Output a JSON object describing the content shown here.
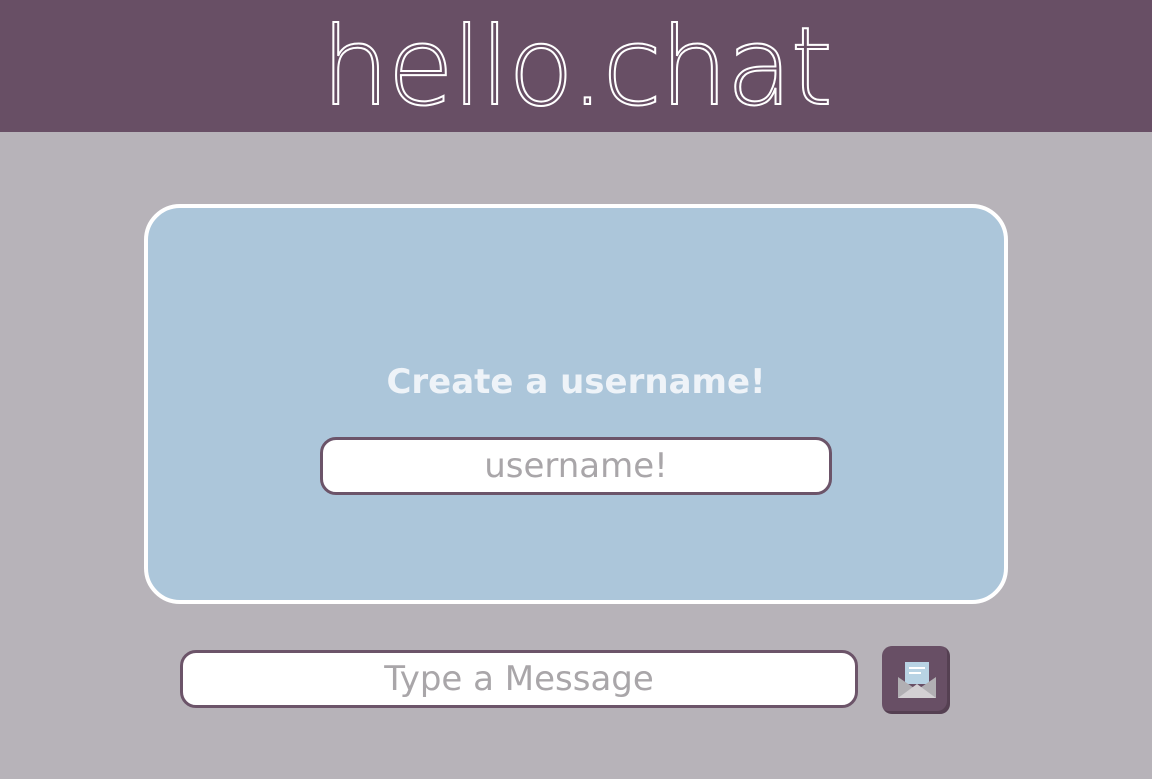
{
  "header": {
    "logo_text": "hello.chat"
  },
  "card": {
    "title": "Create a username!",
    "username_input": {
      "value": "",
      "placeholder": "username!"
    }
  },
  "composer": {
    "message_input": {
      "value": "",
      "placeholder": "Type a Message"
    },
    "send_button_icon": "open-envelope-icon"
  },
  "colors": {
    "header_background": "#684f65",
    "page_background": "#b7b3b9",
    "card_background": "#acc6da",
    "card_border": "#ffffff",
    "input_border": "#6c5469",
    "placeholder_text": "#a9a6a9"
  }
}
